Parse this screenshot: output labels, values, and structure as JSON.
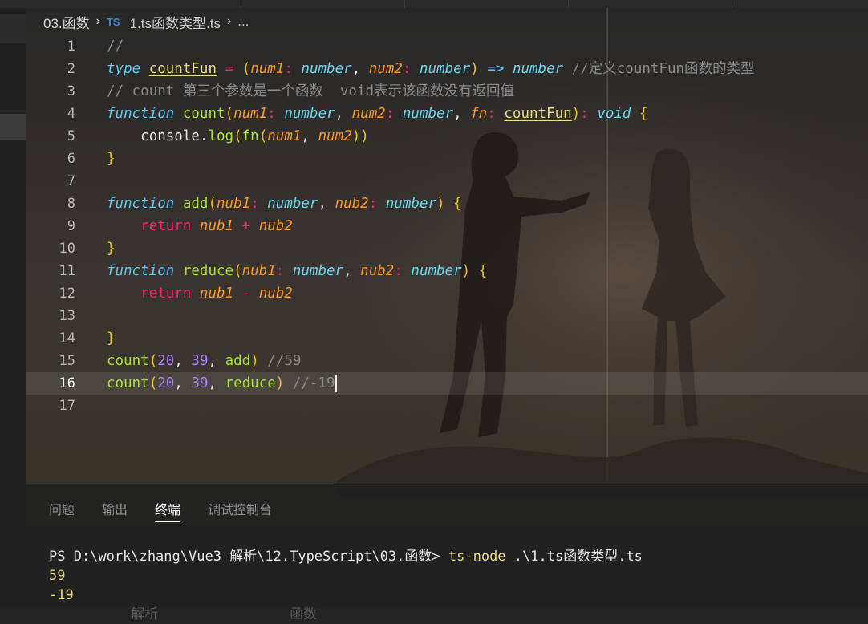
{
  "breadcrumb": {
    "folder": "03.函数",
    "file_badge": "TS",
    "file": "1.ts函数类型.ts",
    "more": "..."
  },
  "editor": {
    "line_numbers": [
      "1",
      "2",
      "3",
      "4",
      "5",
      "6",
      "7",
      "8",
      "9",
      "10",
      "11",
      "12",
      "13",
      "14",
      "15",
      "16",
      "17"
    ],
    "current_line": 16,
    "tokens": {
      "line1_comment": "//",
      "type_kw": "type",
      "countFun": "countFun",
      "eq": "=",
      "num1": "num1",
      "num2": "num2",
      "number": "number",
      "arrow": "=>",
      "line2_comment": "//定义countFun函数的类型",
      "line3_comment": "// count 第三个参数是一个函数  void表示该函数没有返回值",
      "function_kw": "function",
      "count": "count",
      "fn": "fn",
      "void": "void",
      "console": "console",
      "log": "log",
      "add": "add",
      "reduce": "reduce",
      "nub1": "nub1",
      "nub2": "nub2",
      "return_kw": "return",
      "plus": "+",
      "minus": "-",
      "n20": "20",
      "n39": "39",
      "comment59": "//59",
      "comment_neg19": "//-19"
    }
  },
  "panel": {
    "tabs": [
      {
        "label": "问题",
        "active": false
      },
      {
        "label": "输出",
        "active": false
      },
      {
        "label": "终端",
        "active": true
      },
      {
        "label": "调试控制台",
        "active": false
      }
    ],
    "terminal": {
      "prompt": "PS D:\\work\\zhang\\Vue3 解析\\12.TypeScript\\03.函数>",
      "command": "ts-node",
      "args": ".\\1.ts函数类型.ts",
      "output": [
        "59",
        "-19"
      ],
      "next_line_fragment_a": "解析",
      "next_line_fragment_b": "函数"
    }
  },
  "colors": {
    "keyword": "#5cc8f5",
    "function": "#a6e22e",
    "param": "#fd971f",
    "type": "#66d9ef",
    "operator": "#f92672",
    "number": "#ae81ff",
    "comment": "#8a8a8a"
  }
}
